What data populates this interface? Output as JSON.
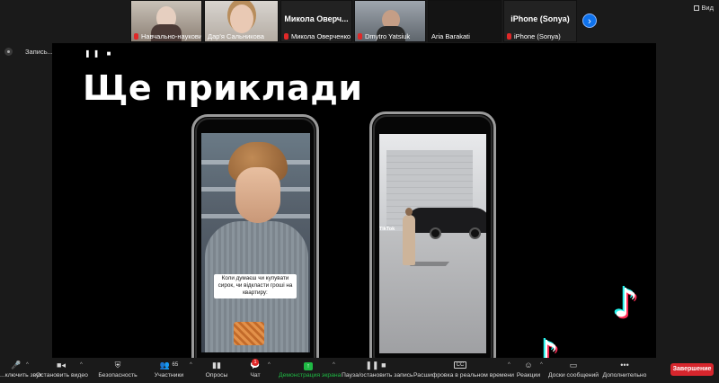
{
  "gallery": {
    "tiles": [
      {
        "name": "Навчально-науковий...",
        "muted": true,
        "has_video": true
      },
      {
        "name": "Дар'я Сальникова",
        "muted": false,
        "has_video": true
      },
      {
        "name": "Микола Оверченко",
        "muted": true,
        "has_video": false,
        "big_name": "Микола Оверч..."
      },
      {
        "name": "Dmytro Yatsiuk",
        "muted": true,
        "has_video": true
      },
      {
        "name": "Aria Barakati",
        "muted": false,
        "has_video": true
      },
      {
        "name": "iPhone (Sonya)",
        "muted": true,
        "has_video": false,
        "big_name": "iPhone (Sonya)"
      }
    ],
    "next_icon": "chevron-right-icon",
    "view_label": "Вид"
  },
  "recording": {
    "label": "Запись..."
  },
  "slide": {
    "title": "Ще приклади",
    "controls": "❚❚ ■",
    "phone1_caption": "Коли думаєш чи купувати сирок, чи відкласти гроші на квартиру:",
    "phone2_watermark": "TikTok",
    "logo_glyph": "♪"
  },
  "toolbar": {
    "items": [
      {
        "id": "audio",
        "label": "...ключить звук",
        "icon": "mic-off-icon"
      },
      {
        "id": "video",
        "label": "Остановить видео",
        "icon": "camera-icon"
      },
      {
        "id": "security",
        "label": "Безопасность",
        "icon": "shield-icon"
      },
      {
        "id": "participants",
        "label": "Участники",
        "icon": "participants-icon",
        "count": "65"
      },
      {
        "id": "polls",
        "label": "Опросы",
        "icon": "poll-icon"
      },
      {
        "id": "chat",
        "label": "Чат",
        "icon": "chat-icon",
        "badge": "1"
      },
      {
        "id": "share",
        "label": "Демонстрация экрана",
        "icon": "share-screen-icon"
      },
      {
        "id": "record",
        "label": "Пауза/остановить запись",
        "icon": "pause-stop-icon"
      },
      {
        "id": "captions",
        "label": "Расшифровка в реальном времени",
        "icon": "cc-icon",
        "icon_text": "CC"
      },
      {
        "id": "reactions",
        "label": "Реакции",
        "icon": "reaction-icon"
      },
      {
        "id": "whiteboard",
        "label": "Доски сообщений",
        "icon": "whiteboard-icon"
      },
      {
        "id": "more",
        "label": "Дополнительно",
        "icon": "more-icon",
        "icon_text": "•••"
      }
    ],
    "end_label": "Завершение"
  },
  "colors": {
    "accent_blue": "#0e72ed",
    "share_green": "#1fb944",
    "end_red": "#d6262d",
    "muted_red": "#e02828"
  }
}
